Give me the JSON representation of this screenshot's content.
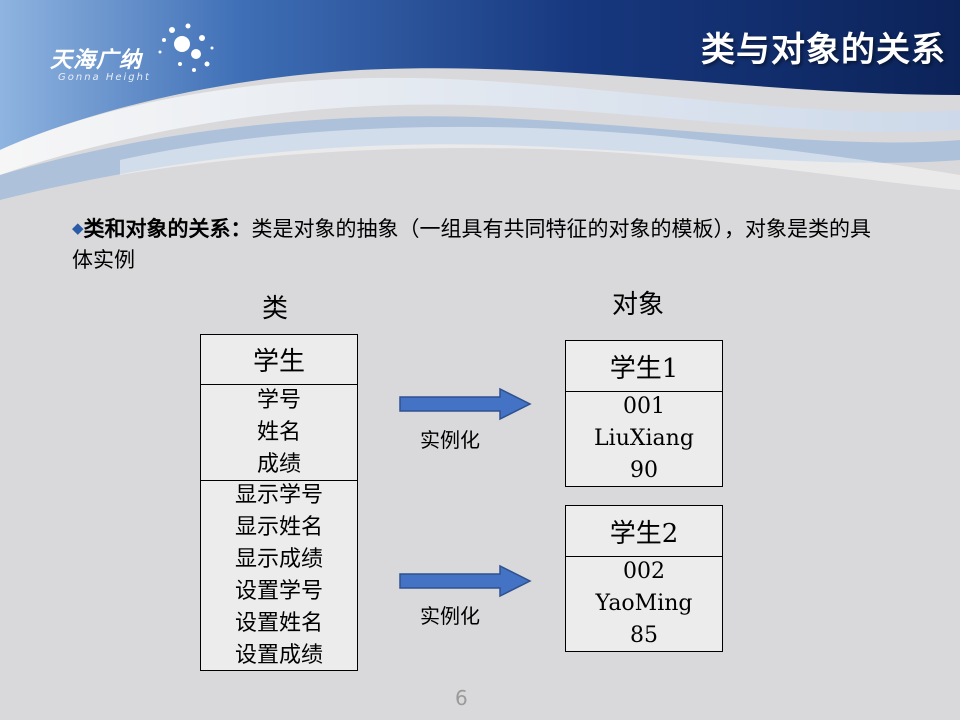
{
  "logo": {
    "name_cn": "天海广纳",
    "name_en": "Gonna Height"
  },
  "slide_title": "类与对象的关系",
  "intro": {
    "bullet": "◆",
    "lead": "类和对象的关系：",
    "text": "类是对象的抽象（一组具有共同特征的对象的模板），对象是类的具体实例"
  },
  "class_header": "类",
  "object_header": "对象",
  "class_box": {
    "name": "学生",
    "attributes": [
      "学号",
      "姓名",
      "成绩"
    ],
    "methods": [
      "显示学号",
      "显示姓名",
      "显示成绩",
      "设置学号",
      "设置姓名",
      "设置成绩"
    ]
  },
  "arrow_label": "实例化",
  "objects": [
    {
      "name": "学生1",
      "values": [
        "001",
        "LiuXiang",
        "90"
      ]
    },
    {
      "name": "学生2",
      "values": [
        "002",
        "YaoMing",
        "85"
      ]
    }
  ],
  "page_number": "6",
  "colors": {
    "banner_dark": "#0f2c6b",
    "banner_light": "#6f9bd1",
    "arrow": "#4472c4",
    "arrow_border": "#2f528f"
  }
}
